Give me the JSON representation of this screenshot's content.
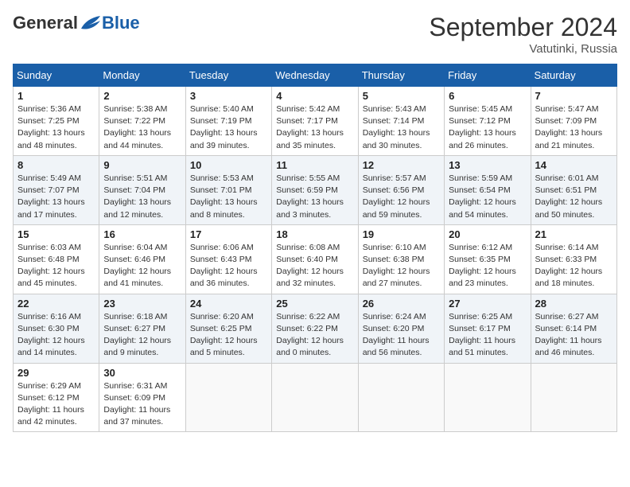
{
  "header": {
    "logo_general": "General",
    "logo_blue": "Blue",
    "month_title": "September 2024",
    "subtitle": "Vatutinki, Russia"
  },
  "weekdays": [
    "Sunday",
    "Monday",
    "Tuesday",
    "Wednesday",
    "Thursday",
    "Friday",
    "Saturday"
  ],
  "weeks": [
    [
      {
        "day": "1",
        "info": "Sunrise: 5:36 AM\nSunset: 7:25 PM\nDaylight: 13 hours\nand 48 minutes."
      },
      {
        "day": "2",
        "info": "Sunrise: 5:38 AM\nSunset: 7:22 PM\nDaylight: 13 hours\nand 44 minutes."
      },
      {
        "day": "3",
        "info": "Sunrise: 5:40 AM\nSunset: 7:19 PM\nDaylight: 13 hours\nand 39 minutes."
      },
      {
        "day": "4",
        "info": "Sunrise: 5:42 AM\nSunset: 7:17 PM\nDaylight: 13 hours\nand 35 minutes."
      },
      {
        "day": "5",
        "info": "Sunrise: 5:43 AM\nSunset: 7:14 PM\nDaylight: 13 hours\nand 30 minutes."
      },
      {
        "day": "6",
        "info": "Sunrise: 5:45 AM\nSunset: 7:12 PM\nDaylight: 13 hours\nand 26 minutes."
      },
      {
        "day": "7",
        "info": "Sunrise: 5:47 AM\nSunset: 7:09 PM\nDaylight: 13 hours\nand 21 minutes."
      }
    ],
    [
      {
        "day": "8",
        "info": "Sunrise: 5:49 AM\nSunset: 7:07 PM\nDaylight: 13 hours\nand 17 minutes."
      },
      {
        "day": "9",
        "info": "Sunrise: 5:51 AM\nSunset: 7:04 PM\nDaylight: 13 hours\nand 12 minutes."
      },
      {
        "day": "10",
        "info": "Sunrise: 5:53 AM\nSunset: 7:01 PM\nDaylight: 13 hours\nand 8 minutes."
      },
      {
        "day": "11",
        "info": "Sunrise: 5:55 AM\nSunset: 6:59 PM\nDaylight: 13 hours\nand 3 minutes."
      },
      {
        "day": "12",
        "info": "Sunrise: 5:57 AM\nSunset: 6:56 PM\nDaylight: 12 hours\nand 59 minutes."
      },
      {
        "day": "13",
        "info": "Sunrise: 5:59 AM\nSunset: 6:54 PM\nDaylight: 12 hours\nand 54 minutes."
      },
      {
        "day": "14",
        "info": "Sunrise: 6:01 AM\nSunset: 6:51 PM\nDaylight: 12 hours\nand 50 minutes."
      }
    ],
    [
      {
        "day": "15",
        "info": "Sunrise: 6:03 AM\nSunset: 6:48 PM\nDaylight: 12 hours\nand 45 minutes."
      },
      {
        "day": "16",
        "info": "Sunrise: 6:04 AM\nSunset: 6:46 PM\nDaylight: 12 hours\nand 41 minutes."
      },
      {
        "day": "17",
        "info": "Sunrise: 6:06 AM\nSunset: 6:43 PM\nDaylight: 12 hours\nand 36 minutes."
      },
      {
        "day": "18",
        "info": "Sunrise: 6:08 AM\nSunset: 6:40 PM\nDaylight: 12 hours\nand 32 minutes."
      },
      {
        "day": "19",
        "info": "Sunrise: 6:10 AM\nSunset: 6:38 PM\nDaylight: 12 hours\nand 27 minutes."
      },
      {
        "day": "20",
        "info": "Sunrise: 6:12 AM\nSunset: 6:35 PM\nDaylight: 12 hours\nand 23 minutes."
      },
      {
        "day": "21",
        "info": "Sunrise: 6:14 AM\nSunset: 6:33 PM\nDaylight: 12 hours\nand 18 minutes."
      }
    ],
    [
      {
        "day": "22",
        "info": "Sunrise: 6:16 AM\nSunset: 6:30 PM\nDaylight: 12 hours\nand 14 minutes."
      },
      {
        "day": "23",
        "info": "Sunrise: 6:18 AM\nSunset: 6:27 PM\nDaylight: 12 hours\nand 9 minutes."
      },
      {
        "day": "24",
        "info": "Sunrise: 6:20 AM\nSunset: 6:25 PM\nDaylight: 12 hours\nand 5 minutes."
      },
      {
        "day": "25",
        "info": "Sunrise: 6:22 AM\nSunset: 6:22 PM\nDaylight: 12 hours\nand 0 minutes."
      },
      {
        "day": "26",
        "info": "Sunrise: 6:24 AM\nSunset: 6:20 PM\nDaylight: 11 hours\nand 56 minutes."
      },
      {
        "day": "27",
        "info": "Sunrise: 6:25 AM\nSunset: 6:17 PM\nDaylight: 11 hours\nand 51 minutes."
      },
      {
        "day": "28",
        "info": "Sunrise: 6:27 AM\nSunset: 6:14 PM\nDaylight: 11 hours\nand 46 minutes."
      }
    ],
    [
      {
        "day": "29",
        "info": "Sunrise: 6:29 AM\nSunset: 6:12 PM\nDaylight: 11 hours\nand 42 minutes."
      },
      {
        "day": "30",
        "info": "Sunrise: 6:31 AM\nSunset: 6:09 PM\nDaylight: 11 hours\nand 37 minutes."
      },
      {
        "day": "",
        "info": ""
      },
      {
        "day": "",
        "info": ""
      },
      {
        "day": "",
        "info": ""
      },
      {
        "day": "",
        "info": ""
      },
      {
        "day": "",
        "info": ""
      }
    ]
  ]
}
